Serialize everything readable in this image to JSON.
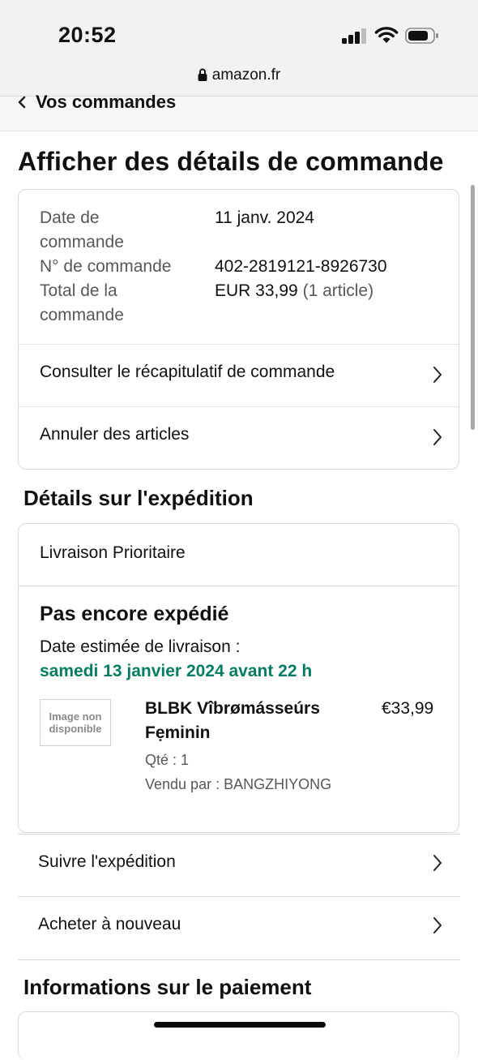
{
  "status_bar": {
    "time": "20:52"
  },
  "browser": {
    "url": "amazon.fr"
  },
  "breadcrumb": {
    "label": "Vos commandes"
  },
  "page_title": "Afficher des détails de commande",
  "order_summary": {
    "date_label": "Date de commande",
    "date_label_l1": "Date de",
    "date_label_l2": "commande",
    "date_value": "11 janv. 2024",
    "number_label": "N° de commande",
    "number_value": "402-2819121-8926730",
    "total_label_l1": "Total de la",
    "total_label_l2": "commande",
    "total_value": "EUR 33,99",
    "total_items": "(1 article)",
    "links": [
      {
        "label": "Consulter le récapitulatif de commande"
      },
      {
        "label": "Annuler des articles"
      }
    ]
  },
  "shipping": {
    "section_title": "Détails sur l'expédition",
    "method": "Livraison Prioritaire",
    "status": "Pas encore expédié",
    "eta_label": "Date estimée de livraison :",
    "eta_value": "samedi 13 janvier 2024 avant 22 h",
    "item": {
      "image_placeholder_l1": "Image non",
      "image_placeholder_l2": "disponible",
      "title_l1": "BLBK Vîbrømásseúrs",
      "title_l2": "Fẹminin",
      "qty": "Qté : 1",
      "seller": "Vendu par : BANGZHIYONG",
      "price": "€33,99"
    },
    "actions": [
      {
        "label": "Suivre l'expédition"
      },
      {
        "label": "Acheter à nouveau"
      }
    ]
  },
  "payment": {
    "section_title": "Informations sur le paiement"
  }
}
